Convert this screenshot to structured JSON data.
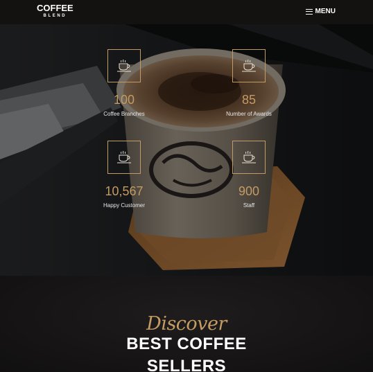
{
  "header": {
    "brand_line1": "COFFEE",
    "brand_line2": "BLEND",
    "menu_label": "MENU",
    "menu_icon": "hamburger-icon"
  },
  "counters": [
    {
      "icon": "coffee-cup-icon",
      "value": "100",
      "label": "Coffee Branches"
    },
    {
      "icon": "coffee-cup-icon",
      "value": "85",
      "label": "Number of Awards"
    },
    {
      "icon": "coffee-cup-icon",
      "value": "10,567",
      "label": "Happy Customer"
    },
    {
      "icon": "coffee-cup-icon",
      "value": "900",
      "label": "Staff"
    }
  ],
  "discover": {
    "script": "Discover",
    "title_line1": "BEST COFFEE",
    "title_line2": "SELLERS"
  },
  "colors": {
    "accent": "#c49b63",
    "header_bg": "#141111",
    "section_bg": "#151313"
  }
}
